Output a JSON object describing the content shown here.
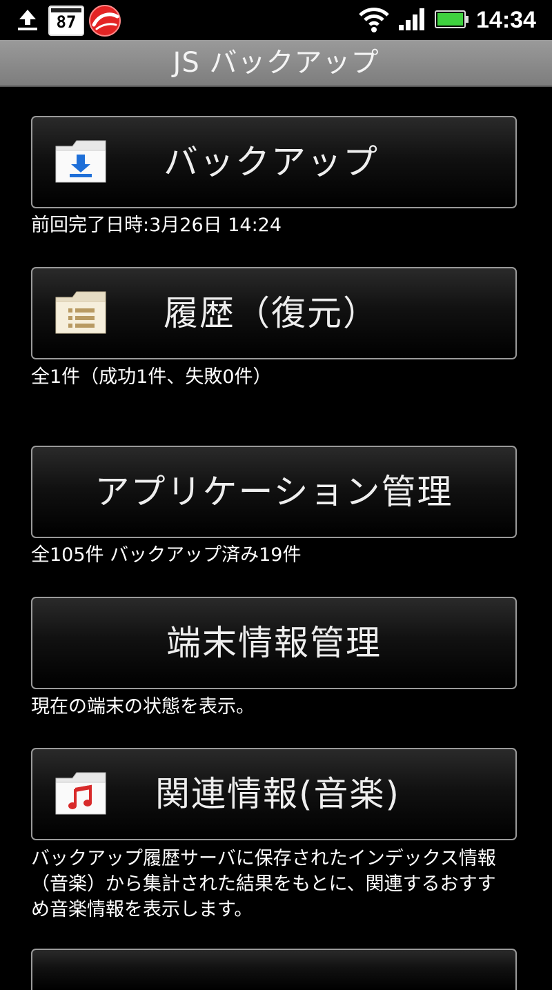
{
  "status_bar": {
    "calendar_day": "87",
    "time": "14:34",
    "icons": [
      "upload-icon",
      "calendar-icon",
      "trend-micro-icon",
      "wifi-icon",
      "signal-icon",
      "battery-icon"
    ]
  },
  "title_bar": {
    "title": "JS バックアップ"
  },
  "menu": [
    {
      "label": "バックアップ",
      "icon": "download-folder-icon",
      "description": "前回完了日時:3月26日 14:24"
    },
    {
      "label": "履歴（復元）",
      "icon": "history-folder-icon",
      "description": "全1件（成功1件、失敗0件）"
    },
    {
      "label": "アプリケーション管理",
      "icon": "",
      "description": "全105件 バックアップ済み19件"
    },
    {
      "label": "端末情報管理",
      "icon": "",
      "description": "現在の端末の状態を表示。"
    },
    {
      "label": "関連情報(音楽)",
      "icon": "music-folder-icon",
      "description": "バックアップ履歴サーバに保存されたインデックス情報（音楽）から集計された結果をもとに、関連するおすすめ音楽情報を表示します。"
    }
  ],
  "colors": {
    "background": "#000000",
    "title_bar": "#8a8a8a",
    "button_border": "#9a9a9a",
    "battery_green": "#3fd13f",
    "music_note": "#d82a2a",
    "download_arrow": "#1e6fd8"
  }
}
